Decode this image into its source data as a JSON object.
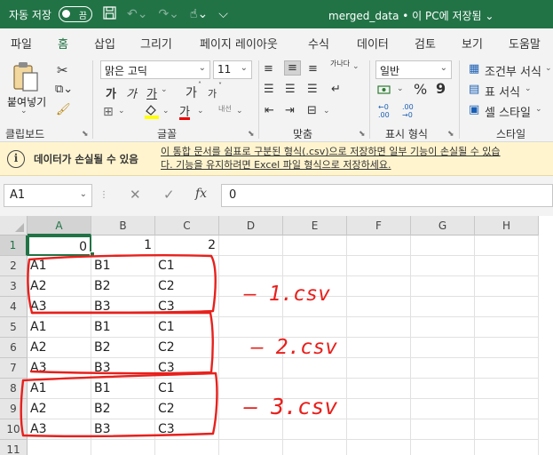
{
  "titlebar": {
    "autosave_label": "자동 저장",
    "autosave_state": "끔",
    "doc_title": "merged_data  •  이 PC에 저장됨  ⌄"
  },
  "menu": {
    "tabs": [
      "파일",
      "홈",
      "삽입",
      "그리기",
      "페이지 레이아웃",
      "수식",
      "데이터",
      "검토",
      "보기",
      "도움말"
    ],
    "active_tab": "홈"
  },
  "ribbon": {
    "paste_label": "붙여넣기",
    "font_name": "맑은 고딕",
    "font_size": "11",
    "bold": "가",
    "italic": "가",
    "underline": "가",
    "grow_font": "가",
    "shrink_font": "가",
    "font_color_glyph": "가",
    "wrap_glyph": "가나다",
    "merge_glyph": "내선",
    "number_format": "일반",
    "percent": "%",
    "comma": "9",
    "conditional_format": "조건부 서식",
    "table_format": "표 서식",
    "cell_styles": "셀 스타일",
    "groups": {
      "clipboard": "클립보드",
      "font": "글꼴",
      "alignment": "맞춤",
      "number": "표시 형식",
      "styles": "스타일"
    }
  },
  "infobar": {
    "title": "데이터가 손실될 수 있음",
    "message_line1": "이 통합 문서를 쉼표로 구분된 형식(.csv)으로 저장하면 일부 기능이 손실될 수 있습",
    "message_line2": "다. 기능을 유지하려면 Excel 파일 형식으로 저장하세요."
  },
  "formula_bar": {
    "name_box": "A1",
    "cancel": "✕",
    "confirm": "✓",
    "fx": "fx",
    "value": "0"
  },
  "sheet": {
    "columns": [
      "A",
      "B",
      "C",
      "D",
      "E",
      "F",
      "G",
      "H"
    ],
    "row_numbers": [
      "1",
      "2",
      "3",
      "4",
      "5",
      "6",
      "7",
      "8",
      "9",
      "10",
      "11"
    ],
    "rows": [
      [
        "0",
        "1",
        "2"
      ],
      [
        "A1",
        "B1",
        "C1"
      ],
      [
        "A2",
        "B2",
        "C2"
      ],
      [
        "A3",
        "B3",
        "C3"
      ],
      [
        "A1",
        "B1",
        "C1"
      ],
      [
        "A2",
        "B2",
        "C2"
      ],
      [
        "A3",
        "B3",
        "C3"
      ],
      [
        "A1",
        "B1",
        "C1"
      ],
      [
        "A2",
        "B2",
        "C2"
      ],
      [
        "A3",
        "B3",
        "C3"
      ],
      [
        "",
        "",
        ""
      ]
    ],
    "active_cell": "A1"
  },
  "annotations": {
    "labels": [
      "— 1.csv",
      "— 2.csv",
      "— 3.csv"
    ],
    "color": "#e8201c"
  },
  "colors": {
    "excel_green": "#217346",
    "infobar_bg": "#fff4ce",
    "ribbon_bg": "#f3f3f3"
  }
}
